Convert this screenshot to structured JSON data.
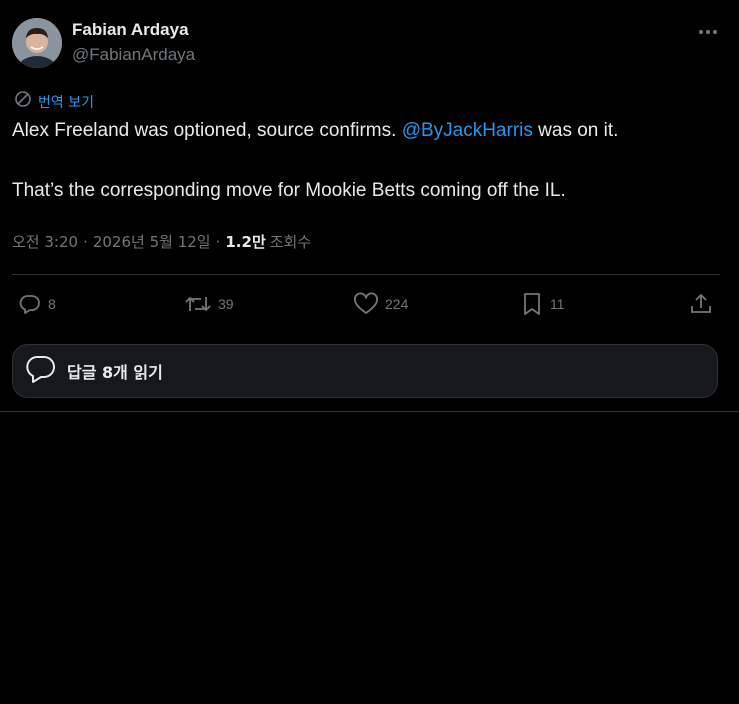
{
  "author": {
    "name": "Fabian Ardaya",
    "handle": "@FabianArdaya"
  },
  "translate_label": "번역 보기",
  "tweet": {
    "line1_before": "Alex Freeland was optioned, source confirms. ",
    "mention": "@ByJackHarris",
    "line1_after": " was on it.",
    "line2": "That’s the corresponding move for Mookie Betts coming off the IL."
  },
  "meta": {
    "time": "오전 3:20",
    "date": "2026년 5월 12일",
    "views_count": "1.2만",
    "views_label": "조회수"
  },
  "actions": {
    "replies": "8",
    "reposts": "39",
    "likes": "224",
    "bookmarks": "11"
  },
  "read_replies_label": "답글 8개 읽기",
  "colors": {
    "background": "#000000",
    "text": "#e7e9ea",
    "muted": "#71767b",
    "accent": "#1d9bf0",
    "border": "#2f3336"
  }
}
